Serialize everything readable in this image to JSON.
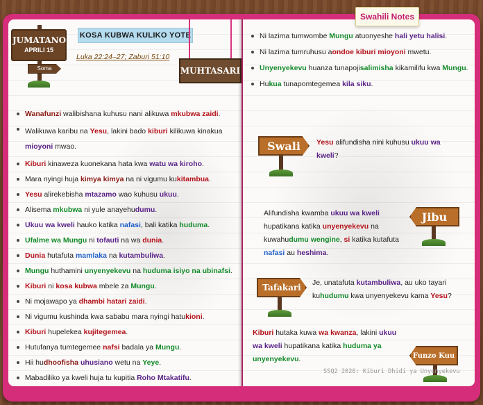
{
  "tag_label": "Swahili Notes",
  "left": {
    "day": "JUMATANO",
    "date": "APRILI 15",
    "soma": "Soma",
    "title": "KOSA KUBWA KULIKO YOTE",
    "refs": "Luka 22:24–27; Zaburi 51:10",
    "muhtasari": "MUHTASARI",
    "bullets": [
      [
        [
          "Wanafunzi",
          "mar"
        ],
        [
          " walibishana kuhusu nani alikuwa ",
          ""
        ],
        [
          "mkubwa zaidi",
          "red"
        ],
        [
          ".",
          ""
        ]
      ],
      [
        [
          "Walikuwa karibu na ",
          ""
        ],
        [
          "Yesu",
          "red"
        ],
        [
          ", lakini bado ",
          ""
        ],
        [
          "kiburi",
          "red"
        ],
        [
          " kilikuwa kinakua ",
          ""
        ],
        [
          "mioyoni",
          "pur"
        ],
        [
          " mwao.",
          ""
        ]
      ],
      [
        [
          "Kiburi",
          "red"
        ],
        [
          " kinaweza kuonekana hata kwa ",
          ""
        ],
        [
          "watu wa kiroho",
          "pur"
        ],
        [
          ".",
          ""
        ]
      ],
      [
        [
          "Mara nyingi huja ",
          ""
        ],
        [
          "kimya kimya",
          "mar"
        ],
        [
          " na ni vigumu ku",
          ""
        ],
        [
          "kitambua",
          "red"
        ],
        [
          ".",
          ""
        ]
      ],
      [
        [
          "Yesu",
          "red"
        ],
        [
          " alirekebisha ",
          ""
        ],
        [
          "mtazamo",
          "pur"
        ],
        [
          " wao kuhusu ",
          ""
        ],
        [
          "ukuu",
          "pur"
        ],
        [
          ".",
          ""
        ]
      ],
      [
        [
          "Alisema ",
          ""
        ],
        [
          "mkubwa",
          "grn"
        ],
        [
          " ni yule anayehu",
          ""
        ],
        [
          "dumu",
          "pur"
        ],
        [
          ".",
          ""
        ]
      ],
      [
        [
          "Ukuu wa kweli",
          "pur"
        ],
        [
          " hauko katika ",
          ""
        ],
        [
          "nafasi",
          "blu"
        ],
        [
          ", bali katika ",
          ""
        ],
        [
          "huduma",
          "grn"
        ],
        [
          ".",
          ""
        ]
      ],
      [
        [
          "Ufalme wa Mungu",
          "grn"
        ],
        [
          " ni ",
          ""
        ],
        [
          "tofauti",
          "pur"
        ],
        [
          " na wa ",
          ""
        ],
        [
          "dunia",
          "red"
        ],
        [
          ".",
          ""
        ]
      ],
      [
        [
          "Dunia",
          "red"
        ],
        [
          " hutafuta ",
          ""
        ],
        [
          "mamlaka",
          "blu"
        ],
        [
          " na ",
          ""
        ],
        [
          "kutambuliwa",
          "pur"
        ],
        [
          ".",
          ""
        ]
      ],
      [
        [
          "Mungu",
          "grn"
        ],
        [
          " huthamini ",
          ""
        ],
        [
          "unyenyekevu",
          "grn"
        ],
        [
          " na ",
          ""
        ],
        [
          "huduma isiyo na ubinafsi",
          "grn"
        ],
        [
          ".",
          ""
        ]
      ],
      [
        [
          "Kiburi",
          "red"
        ],
        [
          " ni ",
          ""
        ],
        [
          "kosa kubwa",
          "red"
        ],
        [
          " mbele za ",
          ""
        ],
        [
          "Mungu",
          "grn"
        ],
        [
          ".",
          ""
        ]
      ],
      [
        [
          "Ni mojawapo ya ",
          ""
        ],
        [
          "dhambi hatari zaidi",
          "red"
        ],
        [
          ".",
          ""
        ]
      ],
      [
        [
          "Ni vigumu kushinda kwa sababu mara nyingi hatu",
          ""
        ],
        [
          "kioni",
          "red"
        ],
        [
          ".",
          ""
        ]
      ],
      [
        [
          "Kiburi",
          "red"
        ],
        [
          " hupelekea ",
          ""
        ],
        [
          "kujitegemea",
          "red"
        ],
        [
          ".",
          ""
        ]
      ],
      [
        [
          "Hutufanya tumtegemee ",
          ""
        ],
        [
          "nafsi",
          "red"
        ],
        [
          " badala ya ",
          ""
        ],
        [
          "Mungu",
          "grn"
        ],
        [
          ".",
          ""
        ]
      ],
      [
        [
          "Hii hu",
          ""
        ],
        [
          "dhoofisha",
          "mar"
        ],
        [
          " ",
          ""
        ],
        [
          "uhusiano",
          "pur"
        ],
        [
          " wetu na ",
          ""
        ],
        [
          "Yeye",
          "grn"
        ],
        [
          ".",
          ""
        ]
      ],
      [
        [
          "Mabadiliko ya kweli huja tu kupitia ",
          ""
        ],
        [
          "Roho Mtakatifu",
          "pur"
        ],
        [
          ".",
          ""
        ]
      ]
    ]
  },
  "right": {
    "bullets": [
      [
        [
          "Ni lazima tumwombe ",
          ""
        ],
        [
          "Mungu",
          "grn"
        ],
        [
          " atuonyeshe ",
          ""
        ],
        [
          "hali yetu halisi",
          "pur"
        ],
        [
          ".",
          ""
        ]
      ],
      [
        [
          "Ni lazima tumruhusu a",
          ""
        ],
        [
          "ondoe kiburi mioyoni",
          "red"
        ],
        [
          " mwetu.",
          ""
        ]
      ],
      [
        [
          "Unyenyekevu",
          "grn"
        ],
        [
          " huanza tunapoji",
          ""
        ],
        [
          "salimisha",
          "grn"
        ],
        [
          " kikamilifu kwa ",
          ""
        ],
        [
          "Mungu",
          "grn"
        ],
        [
          ".",
          ""
        ]
      ],
      [
        [
          "Hu",
          ""
        ],
        [
          "kua",
          "grn"
        ],
        [
          " tunapomtegemea ",
          ""
        ],
        [
          "kila siku",
          "pur"
        ],
        [
          ".",
          ""
        ]
      ]
    ],
    "swali_label": "Swali",
    "swali_text": [
      [
        "Yesu",
        "red"
      ],
      [
        " alifundisha nini kuhusu ",
        ""
      ],
      [
        "ukuu wa kweli",
        "pur"
      ],
      [
        "?",
        ""
      ]
    ],
    "jibu_label": "Jibu",
    "jibu_text": [
      [
        "Alifundisha kwamba ",
        ""
      ],
      [
        "ukuu wa kweli",
        "pur"
      ],
      [
        " hupatikana katika ",
        ""
      ],
      [
        "unyenyekevu",
        "red"
      ],
      [
        " na kuwahu",
        ""
      ],
      [
        "dumu wengine",
        "grn"
      ],
      [
        ", ",
        ""
      ],
      [
        "si",
        "red"
      ],
      [
        " katika kutafuta ",
        ""
      ],
      [
        "nafasi",
        "blu"
      ],
      [
        " au ",
        ""
      ],
      [
        "heshima",
        "pur"
      ],
      [
        ".",
        ""
      ]
    ],
    "tafakari_label": "Tafakari",
    "tafakari_text": [
      [
        "Je, unatafuta ",
        ""
      ],
      [
        "kutambuliwa",
        "pur"
      ],
      [
        ", au uko tayari ku",
        ""
      ],
      [
        "hudumu",
        "grn"
      ],
      [
        " kwa unyenyekevu kama ",
        ""
      ],
      [
        "Yesu",
        "red"
      ],
      [
        "?",
        ""
      ]
    ],
    "funzo_label": "Funzo Kuu",
    "funzo_text": [
      [
        "Kiburi",
        "red"
      ],
      [
        " hutaka kuwa ",
        ""
      ],
      [
        "wa kwanza",
        "red"
      ],
      [
        ", lakini ",
        ""
      ],
      [
        "ukuu wa kweli",
        "pur"
      ],
      [
        " hupatikana katika ",
        ""
      ],
      [
        "huduma ya unyenyekevu",
        "grn"
      ],
      [
        ".",
        ""
      ]
    ],
    "footer": "SSQ2 2026: Kiburi Dhidi ya Unyenyekevu"
  }
}
